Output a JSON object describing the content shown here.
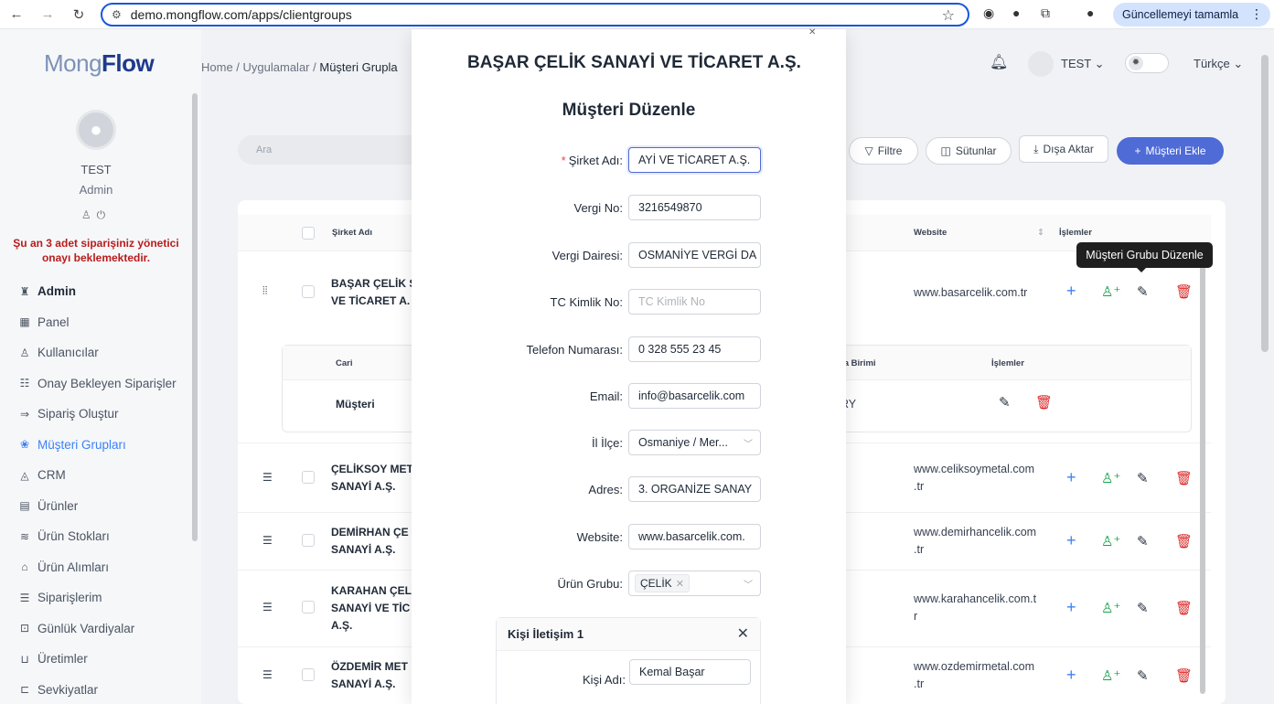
{
  "browser": {
    "url": "demo.mongflow.com/apps/clientgroups",
    "update_label": "Güncellemeyi tamamla"
  },
  "sidebar": {
    "logo_light": "Mong",
    "logo_bold": "Flow",
    "user_name": "TEST",
    "user_role": "Admin",
    "warning": "Şu an 3 adet siparişiniz yönetici onayı beklemektedir.",
    "items": [
      {
        "label": "Admin",
        "icon": "admin-icon"
      },
      {
        "label": "Panel",
        "icon": "panel-icon"
      },
      {
        "label": "Kullanıcılar",
        "icon": "users-icon"
      },
      {
        "label": "Onay Bekleyen Siparişler",
        "icon": "pending-icon"
      },
      {
        "label": "Sipariş Oluştur",
        "icon": "order-create-icon"
      },
      {
        "label": "Müşteri Grupları",
        "icon": "client-groups-icon"
      },
      {
        "label": "CRM",
        "icon": "crm-icon"
      },
      {
        "label": "Ürünler",
        "icon": "products-icon"
      },
      {
        "label": "Ürün Stokları",
        "icon": "stock-icon"
      },
      {
        "label": "Ürün Alımları",
        "icon": "purchase-icon"
      },
      {
        "label": "Siparişlerim",
        "icon": "my-orders-icon"
      },
      {
        "label": "Günlük Vardiyalar",
        "icon": "shifts-icon"
      },
      {
        "label": "Üretimler",
        "icon": "production-icon"
      },
      {
        "label": "Sevkiyatlar",
        "icon": "shipment-icon"
      }
    ]
  },
  "header": {
    "breadcrumb": [
      "Home",
      "Uygulamalar",
      "Müşteri Grupla"
    ],
    "user": "TEST",
    "language": "Türkçe"
  },
  "toolbar": {
    "search_placeholder": "Ara",
    "filter": "Filtre",
    "columns": "Sütunlar",
    "export": "Dışa Aktar",
    "add": "Müşteri Ekle"
  },
  "table": {
    "headers": {
      "company": "Şirket Adı",
      "website": "Website",
      "actions": "İşlemler"
    },
    "rows": [
      {
        "name1": "BAŞAR ÇELİK S",
        "name2": "VE TİCARET A.",
        "name3": "",
        "site1": "www.basarcelik.com.tr",
        "site2": ""
      },
      {
        "name1": "ÇELİKSOY MET",
        "name2": "SANAYİ A.Ş.",
        "name3": "",
        "site1": "www.celiksoymetal.com",
        "site2": ".tr"
      },
      {
        "name1": "DEMİRHAN ÇE",
        "name2": "SANAYİ A.Ş.",
        "name3": "",
        "site1": "www.demirhancelik.com",
        "site2": ".tr"
      },
      {
        "name1": "KARAHAN ÇEL",
        "name2": "SANAYİ VE TİC",
        "name3": "A.Ş.",
        "site1": "www.karahancelik.com.t",
        "site2": "r"
      },
      {
        "name1": "ÖZDEMİR MET",
        "name2": "SANAYİ A.Ş.",
        "name3": "",
        "site1": "www.ozdemirmetal.com",
        "site2": ".tr"
      }
    ],
    "subtable": {
      "header_cari": "Cari",
      "header_currency": "ra Birimi",
      "header_actions": "İşlemler",
      "row_cari": "Müşteri",
      "row_currency": "RY"
    },
    "tooltip": "Müşteri Grubu Düzenle"
  },
  "modal": {
    "title": "BAŞAR ÇELİK SANAYİ VE TİCARET A.Ş.",
    "subtitle": "Müşteri Düzenle",
    "fields": [
      {
        "label": "Şirket Adı",
        "value": "AYİ VE TİCARET A.Ş.",
        "required": true
      },
      {
        "label": "Vergi No",
        "value": "3216549870"
      },
      {
        "label": "Vergi Dairesi",
        "value": "OSMANİYE VERGİ DA"
      },
      {
        "label": "TC Kimlik No",
        "placeholder": "TC Kimlik No"
      },
      {
        "label": "Telefon Numarası",
        "value": "0 328 555 23 45"
      },
      {
        "label": "Email",
        "value": "info@basarcelik.com"
      },
      {
        "label": "İl İlçe",
        "value": "Osmaniye / Mer..."
      },
      {
        "label": "Adres",
        "value": "3. ORGANİZE SANAY"
      },
      {
        "label": "Website",
        "value": "www.basarcelik.com."
      },
      {
        "label": "Ürün Grubu",
        "tag": "ÇELİK"
      }
    ],
    "contact": {
      "title": "Kişi İletişim 1",
      "name_label": "Kişi Adı",
      "name_value": "Kemal Başar"
    }
  }
}
